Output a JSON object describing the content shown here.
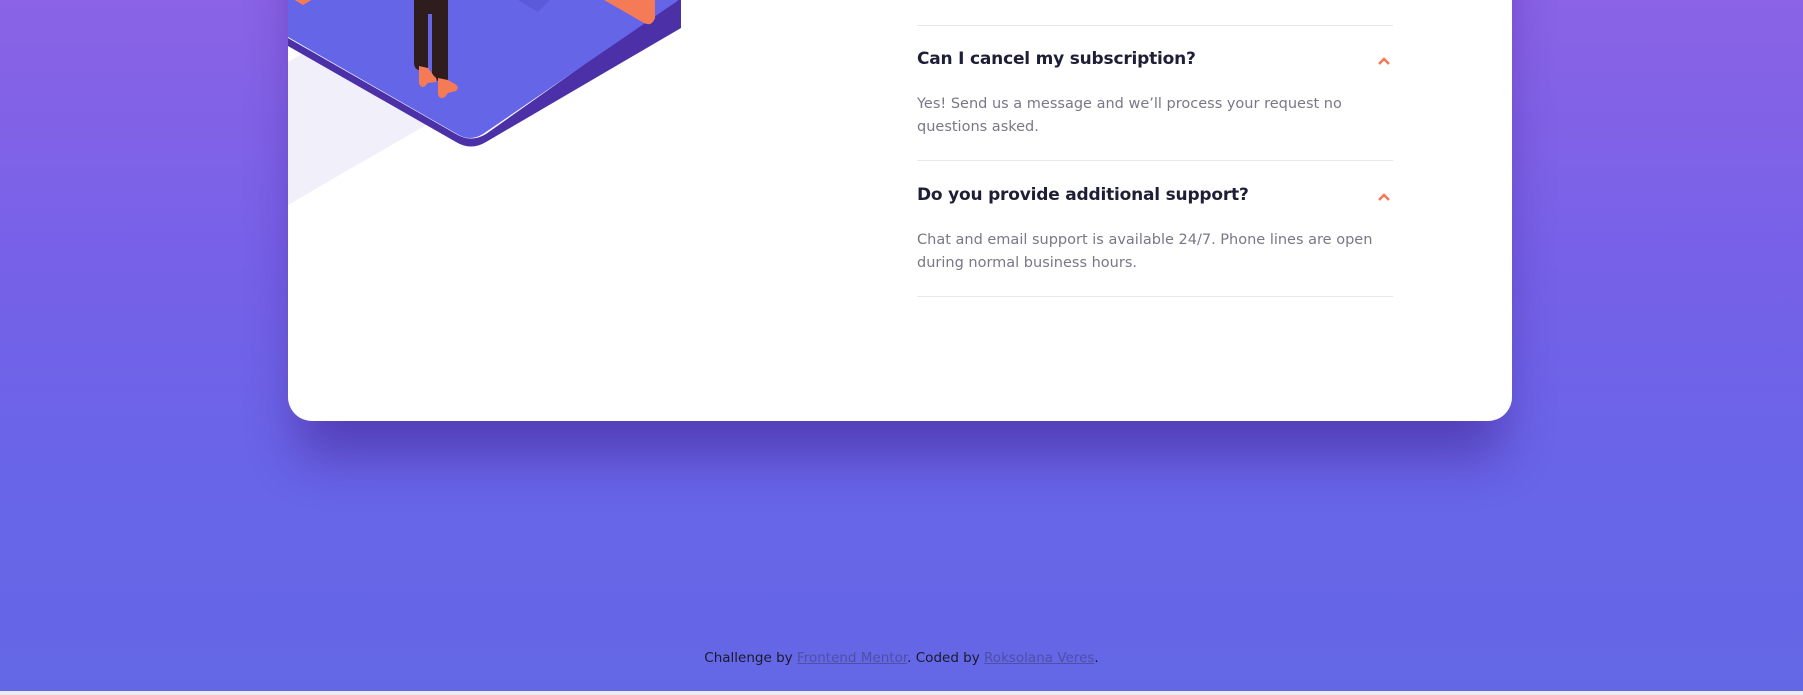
{
  "faq": {
    "items": [
      {
        "question": "Can I cancel my subscription?",
        "answer": "Yes! Send us a message and we’ll process your request no questions asked.",
        "chevron_icon": "chevron-up-icon",
        "expanded": true
      },
      {
        "question": "Do you provide additional support?",
        "answer": "Chat and email support is available 24/7. Phone lines are open during normal business hours.",
        "chevron_icon": "chevron-up-icon",
        "expanded": true
      }
    ]
  },
  "footer": {
    "prefix": "Challenge by ",
    "link1": "Frontend Mentor",
    "middle": ". Coded by ",
    "link2": "Roksolana Veres",
    "suffix": "."
  },
  "colors": {
    "background_top": "#8a63e6",
    "background_bottom": "#6367e6",
    "card": "#ffffff",
    "accent": "#f47b56",
    "heading": "#1e1f36",
    "body_text": "#787887",
    "platform": "#6565e7",
    "platform_shadow_edge": "#4b30a8",
    "shadow_shape": "#f0effa"
  }
}
